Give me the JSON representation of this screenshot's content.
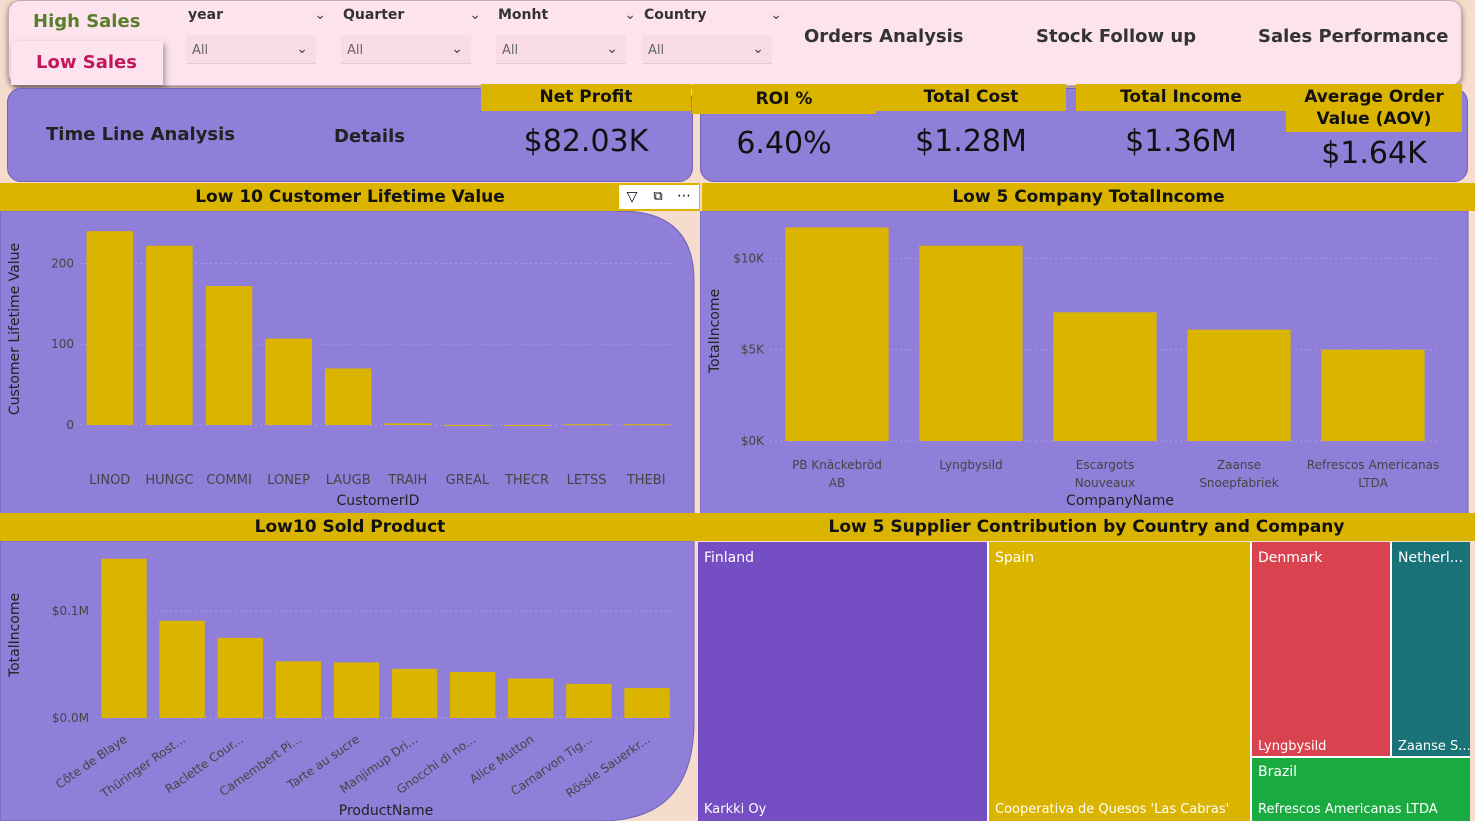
{
  "nav": {
    "high_sales": "High Sales",
    "low_sales": "Low Sales",
    "slicers": [
      {
        "label": "year",
        "value": "All"
      },
      {
        "label": "Quarter",
        "value": "All"
      },
      {
        "label": "Monht",
        "value": "All"
      },
      {
        "label": "Country",
        "value": "All"
      }
    ],
    "orders_analysis": "Orders Analysis",
    "stock_follow_up": "Stock Follow up",
    "sales_performance": "Sales Performance"
  },
  "left_panel": {
    "timeline": "Time Line Analysis",
    "details": "Details",
    "net_profit_label": "Net Profit",
    "net_profit_value": "$82.03K"
  },
  "kpis": {
    "roi_label": "ROI %",
    "roi_value": "6.40%",
    "total_cost_label": "Total Cost",
    "total_cost_value": "$1.28M",
    "total_income_label": "Total Income",
    "total_income_value": "$1.36M",
    "aov_label": "Average Order Value (AOV)",
    "aov_value": "$1.64K"
  },
  "colors": {
    "bar": "#dbb400",
    "panel": "#8f7fd8",
    "finland": "#744ec2",
    "spain": "#dbb400",
    "denmark": "#d9434f",
    "netherlands": "#197278",
    "brazil": "#1aab40"
  },
  "chart_data": [
    {
      "type": "bar",
      "title": "Low 10 Customer Lifetime Value",
      "xlabel": "CustomerID",
      "ylabel": "Customer Lifetime Value",
      "categories": [
        "LINOD",
        "HUNGC",
        "COMMI",
        "LONEP",
        "LAUGB",
        "TRAIH",
        "GREAL",
        "THECR",
        "LETSS",
        "THEBI"
      ],
      "values": [
        240,
        222,
        172,
        107,
        70,
        2,
        0,
        0,
        1,
        1
      ],
      "ylim": [
        0,
        260
      ],
      "yticks": [
        "0",
        "100",
        "200"
      ]
    },
    {
      "type": "bar",
      "title": "Low 5 Company TotalIncome",
      "xlabel": "CompanyName",
      "ylabel": "TotalIncome",
      "categories": [
        "PB Knäckebröd AB",
        "Lyngbysild",
        "Escargots Nouveaux",
        "Zaanse Snoepfabriek",
        "Refrescos Americanas LTDA"
      ],
      "values": [
        11700,
        10700,
        7050,
        6100,
        5000
      ],
      "ylim": [
        0,
        12600
      ],
      "yticks": [
        "$0K",
        "$5K",
        "$10K"
      ]
    },
    {
      "type": "bar",
      "title": "Low10 Sold Product",
      "xlabel": "ProductName",
      "ylabel": "TotalIncome",
      "categories": [
        "Côte de Blaye",
        "Thüringer Rost...",
        "Raclette Cour...",
        "Camembert Pi...",
        "Tarte au sucre",
        "Manjimup Dri...",
        "Gnocchi di no...",
        "Alice Mutton",
        "Carnarvon Tig...",
        "Rössle Sauerkr..."
      ],
      "values": [
        0.149,
        0.091,
        0.075,
        0.053,
        0.052,
        0.046,
        0.043,
        0.037,
        0.032,
        0.028
      ],
      "ylim": [
        0,
        0.16
      ],
      "yticks": [
        "$0.0M",
        "$0.1M"
      ]
    },
    {
      "type": "treemap",
      "title": "Low 5 Supplier Contribution by Country and Company",
      "nodes": [
        {
          "country": "Finland",
          "company": "Karkki Oy"
        },
        {
          "country": "Spain",
          "company": "Cooperativa de Quesos 'Las Cabras'"
        },
        {
          "country": "Denmark",
          "company": "Lyngbysild"
        },
        {
          "country": "Netherl...",
          "company": "Zaanse S..."
        },
        {
          "country": "Brazil",
          "company": "Refrescos Americanas LTDA"
        }
      ]
    }
  ]
}
